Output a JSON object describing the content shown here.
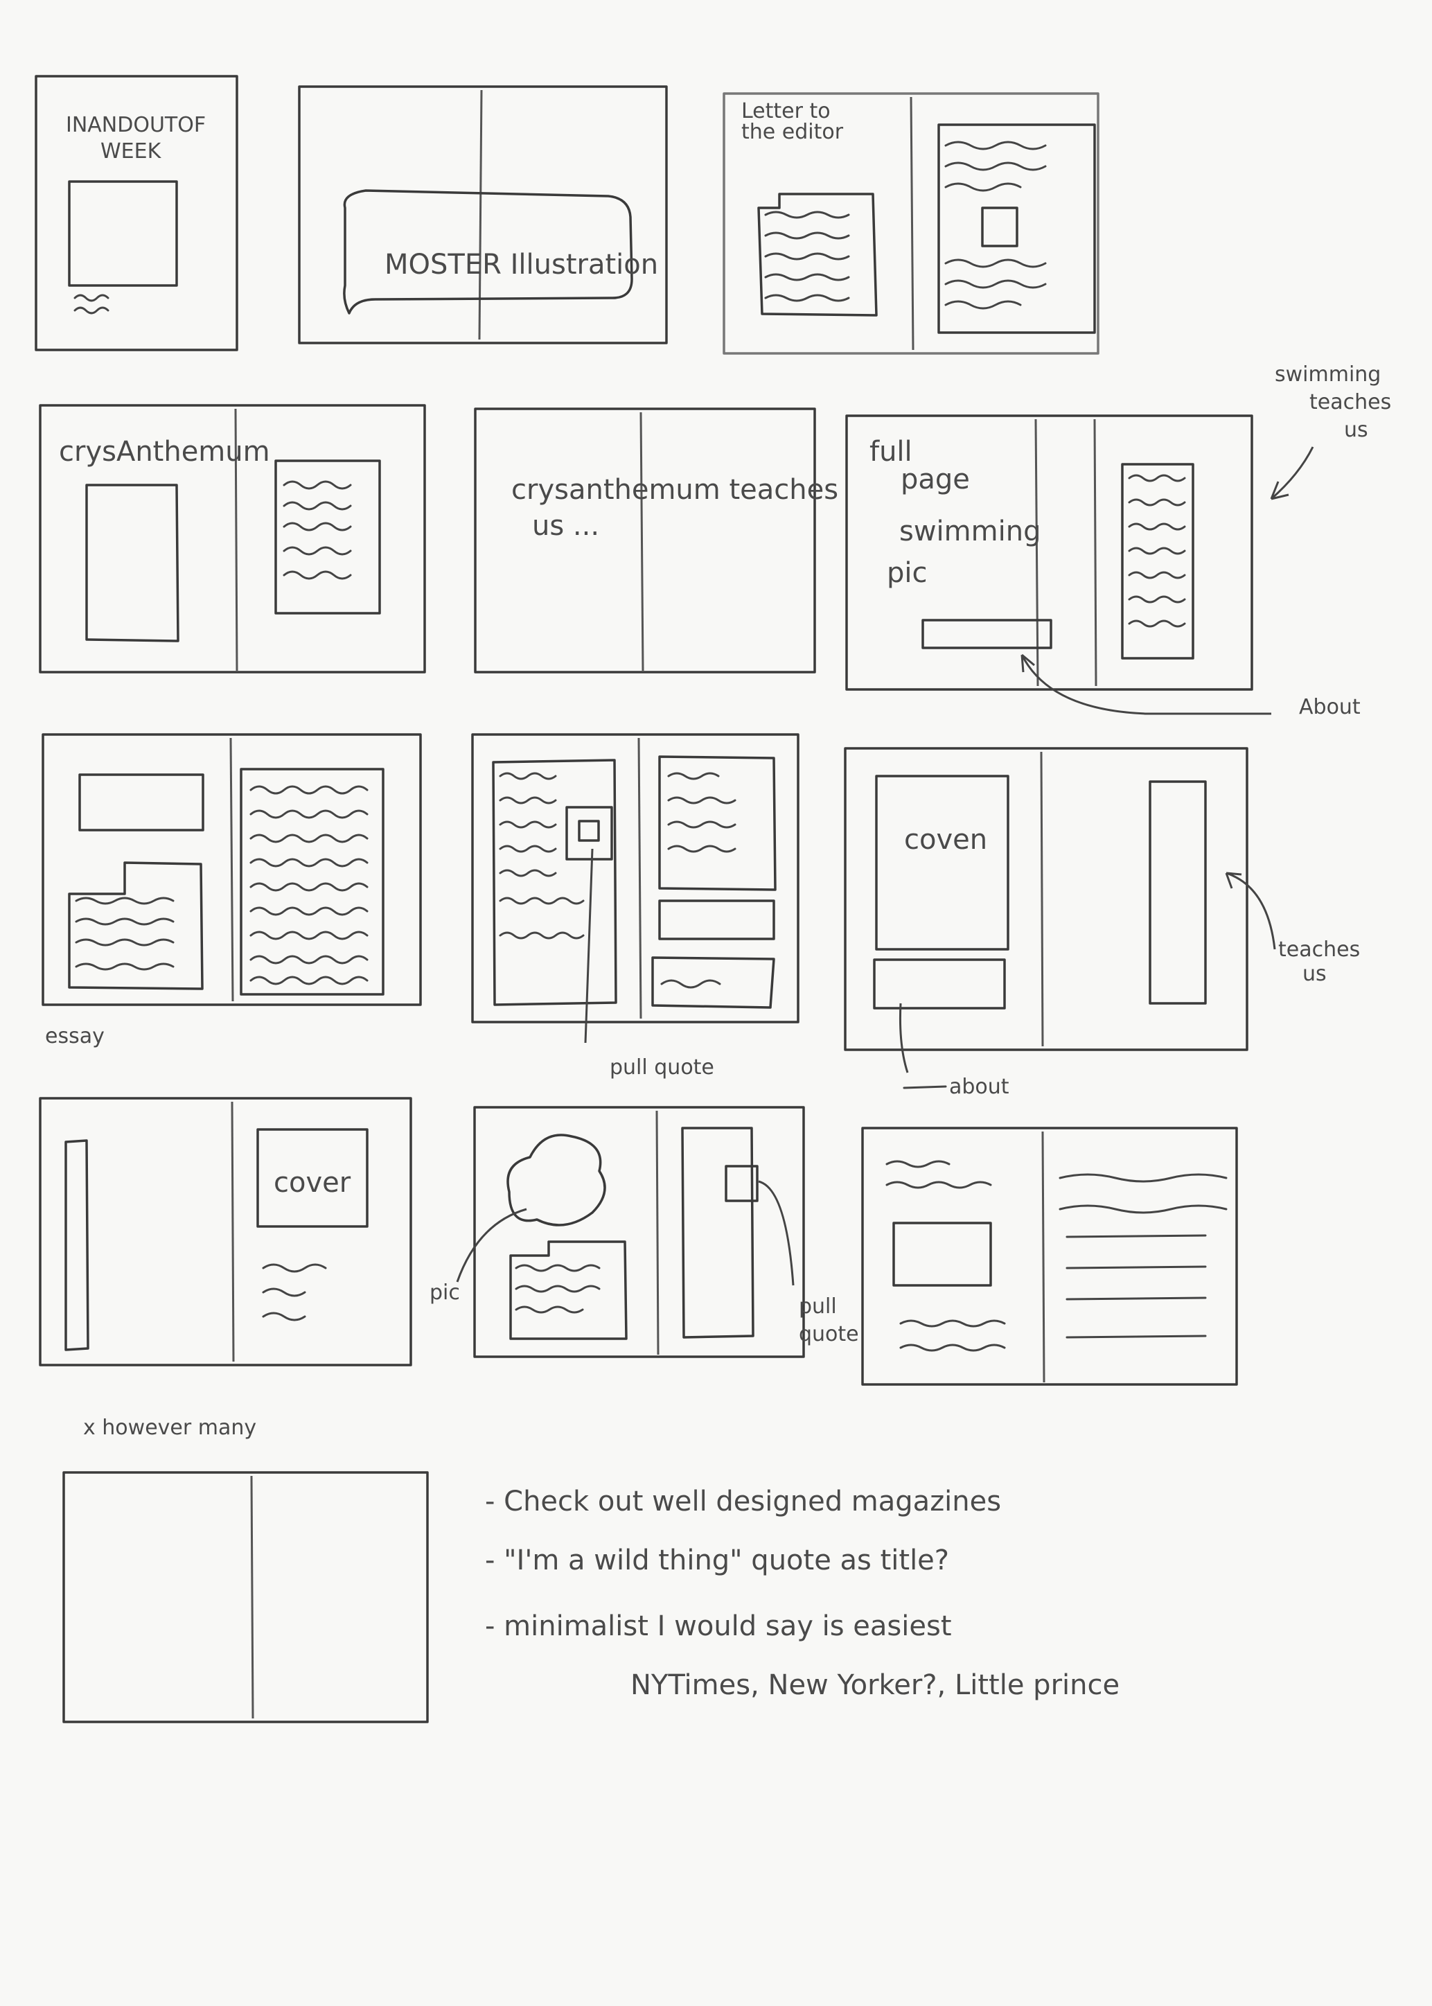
{
  "sheet": {
    "row1": {
      "cover_title_line1": "INANDOUTOF",
      "cover_title_line2": "WEEK",
      "poster_label": "MOSTER Illustration",
      "letters_label_line1": "Letter to",
      "letters_label_line2": "the editor"
    },
    "row2": {
      "spread1_label": "crysAnthemum",
      "spread2_label_line1": "crysanthemum teaches",
      "spread2_label_line2": "us ...",
      "spread3_label_line1": "full",
      "spread3_label_line2": "page",
      "spread3_label_line3": "swimming",
      "spread3_label_line4": "pic",
      "side_note_line1": "swimming",
      "side_note_line2": "teaches",
      "side_note_line3": "us",
      "about_note": "About"
    },
    "row3": {
      "essay_note": "essay",
      "pull_quote_note": "pull quote",
      "cover_label": "coven",
      "teaches_note_line1": "teaches",
      "teaches_note_line2": "us",
      "about_note": "about"
    },
    "row4": {
      "cover_label": "cover",
      "pic_note": "pic",
      "pull_quote_note_line1": "pull",
      "pull_quote_note_line2": "quote",
      "repeat_note": "x however many"
    },
    "notes": [
      "- Check out well designed magazines",
      "- \"I'm a wild thing\" quote as title?",
      "- minimalist I would say is easiest",
      "NYTimes, New Yorker?, Little prince"
    ]
  }
}
